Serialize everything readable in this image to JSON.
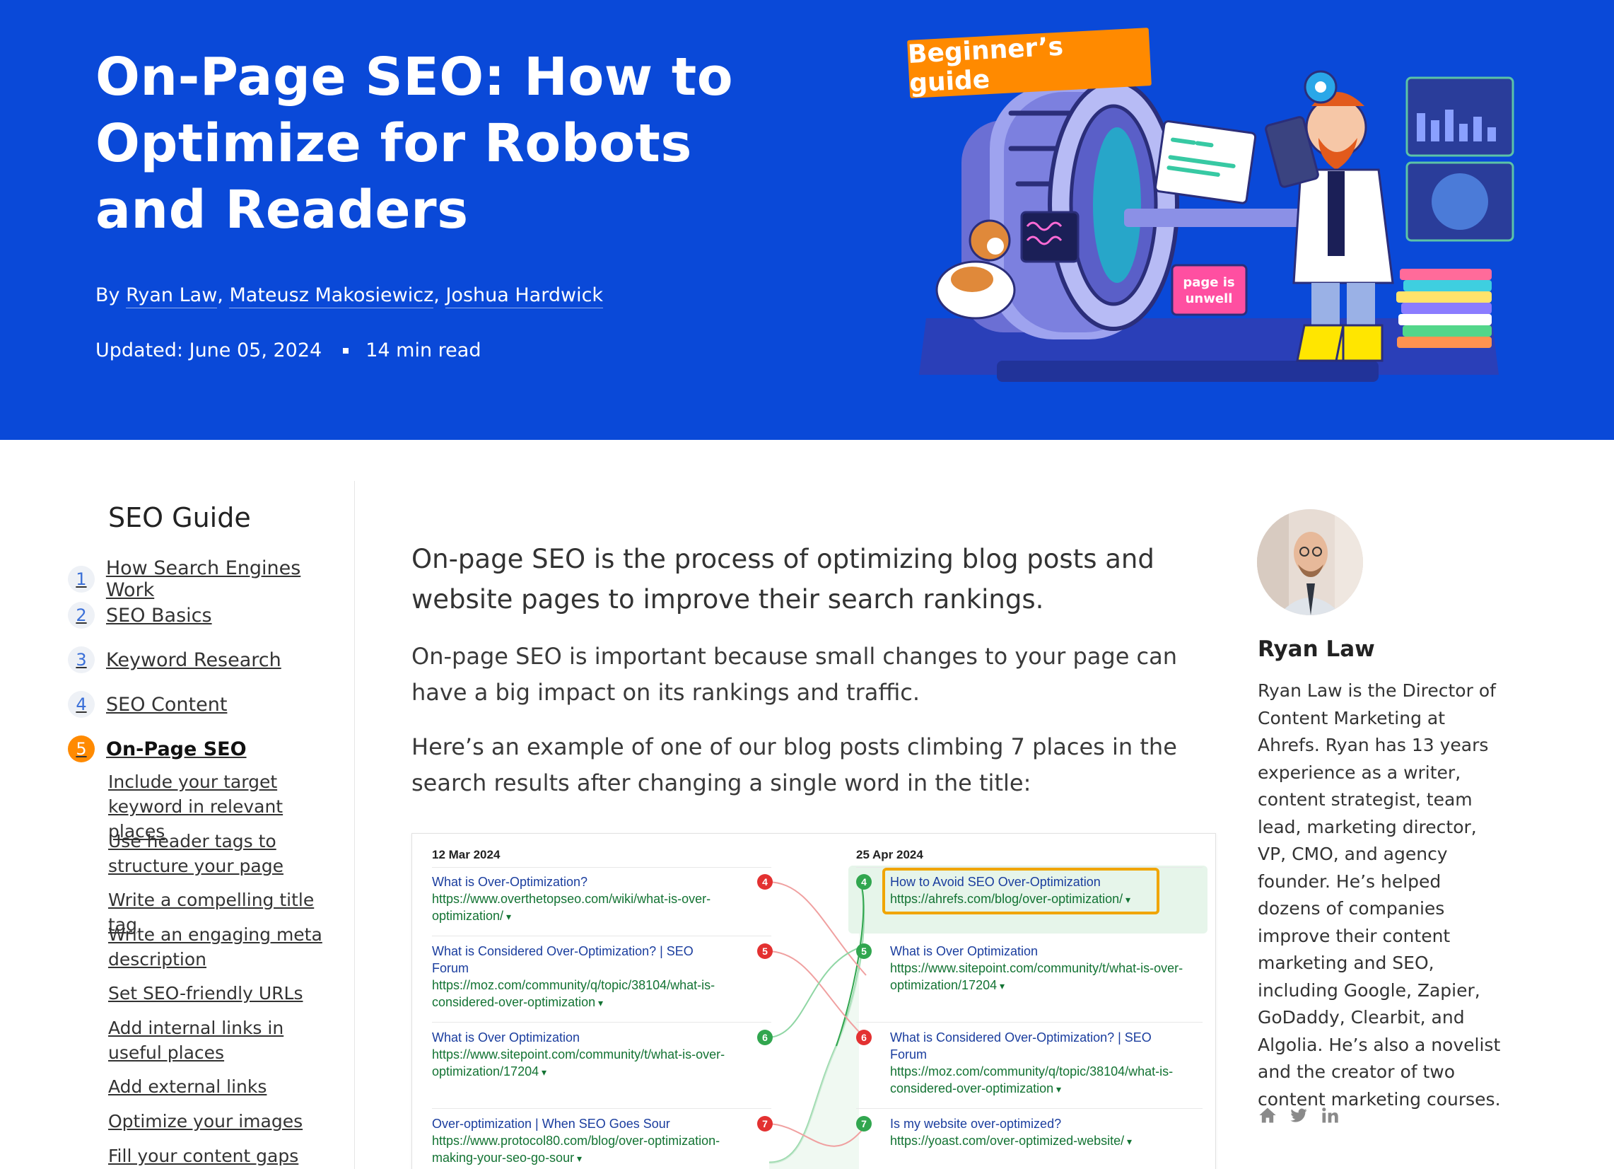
{
  "hero": {
    "title": "On-Page SEO: How to Optimize for Robots and Readers",
    "by_prefix": "By",
    "authors": [
      "Ryan Law",
      "Mateusz Makosiewicz",
      "Joshua Hardwick"
    ],
    "updated": "Updated: June 05, 2024",
    "read_time": "14 min read",
    "badge": "Beginner’s guide",
    "illustration_sign": [
      "page is",
      "unwell"
    ]
  },
  "sidebar": {
    "title": "SEO Guide",
    "items": [
      {
        "num": "1",
        "label": "How Search Engines Work"
      },
      {
        "num": "2",
        "label": "SEO Basics"
      },
      {
        "num": "3",
        "label": "Keyword Research"
      },
      {
        "num": "4",
        "label": "SEO Content"
      },
      {
        "num": "5",
        "label": "On-Page SEO"
      }
    ],
    "subitems": [
      "Include your target keyword in relevant places",
      "Use header tags to structure your page",
      "Write a compelling title tag",
      "Write an engaging meta description",
      "Set SEO-friendly URLs",
      "Add internal links in useful places",
      "Add external links",
      "Optimize your images",
      "Fill your content gaps"
    ]
  },
  "main": {
    "lead": "On-page SEO is the process of optimizing blog posts and website pages to improve their search rankings.",
    "para1": "On-page SEO is important because small changes to your page can have a big impact on its rankings and traffic.",
    "para2": "Here’s an example of one of our blog posts climbing 7 places in the search results after changing a single word in the title:"
  },
  "serp": {
    "left_date": "12 Mar 2024",
    "right_date": "25 Apr 2024",
    "left": [
      {
        "rank": "4",
        "title": "What is Over-Optimization?",
        "url": "https://www.overthetopseo.com/wiki/what-is-over-optimization/"
      },
      {
        "rank": "5",
        "title": "What is Considered Over-Optimization? | SEO Forum",
        "url": "https://moz.com/community/q/topic/38104/what-is-considered-over-optimization"
      },
      {
        "rank": "6",
        "title": "What is Over Optimization",
        "url": "https://www.sitepoint.com/community/t/what-is-over-optimization/17204"
      },
      {
        "rank": "7",
        "title": "Over-optimization | When SEO Goes Sour",
        "url": "https://www.protocol80.com/blog/over-optimization-making-your-seo-go-sour"
      }
    ],
    "right": [
      {
        "rank": "4",
        "title": "How to Avoid SEO Over-Optimization",
        "url": "https://ahrefs.com/blog/over-optimization/"
      },
      {
        "rank": "5",
        "title": "What is Over Optimization",
        "url": "https://www.sitepoint.com/community/t/what-is-over-optimization/17204"
      },
      {
        "rank": "6",
        "title": "What is Considered Over-Optimization? | SEO Forum",
        "url": "https://moz.com/community/q/topic/38104/what-is-considered-over-optimization"
      },
      {
        "rank": "7",
        "title": "Is my website over-optimized?",
        "url": "https://yoast.com/over-optimized-website/"
      }
    ]
  },
  "author": {
    "name": "Ryan Law",
    "bio": "Ryan Law is the Director of Content Marketing at Ahrefs. Ryan has 13 years experience as a writer, content strategist, team lead, marketing director, VP, CMO, and agency founder. He’s helped dozens of companies improve their content marketing and SEO, including Google, Zapier, GoDaddy, Clearbit, and Algolia. He’s also a novelist and the creator of two content marketing courses.",
    "socials": [
      "home-icon",
      "twitter-icon",
      "linkedin-icon"
    ]
  },
  "colors": {
    "hero_bg": "#0a49d8",
    "accent_orange": "#ff8a00",
    "link_blue": "#1a3d9e",
    "url_green": "#137333",
    "rank_down_red": "#e33131",
    "rank_up_green": "#31a64f"
  }
}
